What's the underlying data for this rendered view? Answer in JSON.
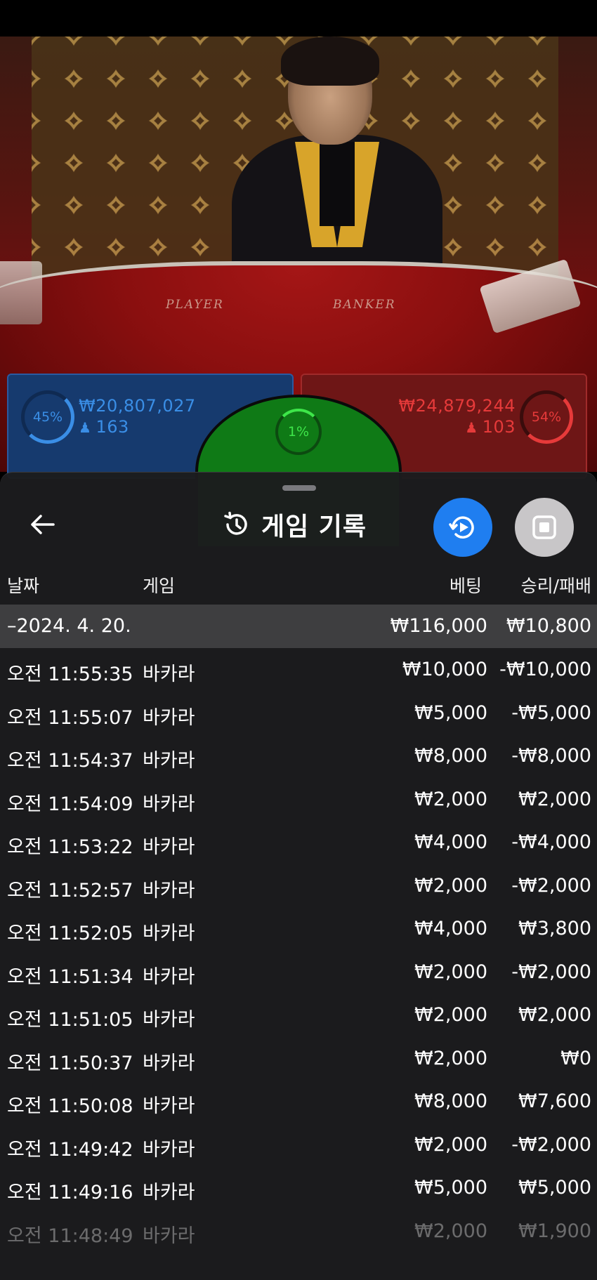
{
  "video": {
    "table_player_label": "PLAYER",
    "table_banker_label": "BANKER"
  },
  "bets": {
    "player": {
      "percent": "45%",
      "amount": "₩20,807,027",
      "count": "163",
      "color": "#3a8ee6"
    },
    "tie": {
      "percent": "1%",
      "color": "#3ee64a"
    },
    "banker": {
      "percent": "54%",
      "amount": "₩24,879,244",
      "count": "103",
      "color": "#e63a3a"
    }
  },
  "sheet": {
    "title": "게임 기록",
    "columns": {
      "date": "날짜",
      "game": "게임",
      "bet": "베팅",
      "result": "승리/패배"
    },
    "date_row": {
      "date": "–2024. 4. 20.",
      "bet": "₩116,000",
      "result": "₩10,800"
    },
    "rows": [
      {
        "time": "오전 11:55:35",
        "game": "바카라",
        "bet": "₩10,000",
        "result": "-₩10,000"
      },
      {
        "time": "오전 11:55:07",
        "game": "바카라",
        "bet": "₩5,000",
        "result": "-₩5,000"
      },
      {
        "time": "오전 11:54:37",
        "game": "바카라",
        "bet": "₩8,000",
        "result": "-₩8,000"
      },
      {
        "time": "오전 11:54:09",
        "game": "바카라",
        "bet": "₩2,000",
        "result": "₩2,000"
      },
      {
        "time": "오전 11:53:22",
        "game": "바카라",
        "bet": "₩4,000",
        "result": "-₩4,000"
      },
      {
        "time": "오전 11:52:57",
        "game": "바카라",
        "bet": "₩2,000",
        "result": "-₩2,000"
      },
      {
        "time": "오전 11:52:05",
        "game": "바카라",
        "bet": "₩4,000",
        "result": "₩3,800"
      },
      {
        "time": "오전 11:51:34",
        "game": "바카라",
        "bet": "₩2,000",
        "result": "-₩2,000"
      },
      {
        "time": "오전 11:51:05",
        "game": "바카라",
        "bet": "₩2,000",
        "result": "₩2,000"
      },
      {
        "time": "오전 11:50:37",
        "game": "바카라",
        "bet": "₩2,000",
        "result": "₩0"
      },
      {
        "time": "오전 11:50:08",
        "game": "바카라",
        "bet": "₩8,000",
        "result": "₩7,600"
      },
      {
        "time": "오전 11:49:42",
        "game": "바카라",
        "bet": "₩2,000",
        "result": "-₩2,000"
      },
      {
        "time": "오전 11:49:16",
        "game": "바카라",
        "bet": "₩5,000",
        "result": "₩5,000"
      },
      {
        "time": "오전 11:48:49",
        "game": "바카라",
        "bet": "₩2,000",
        "result": "₩1,900"
      }
    ],
    "icons": {
      "back": "arrow-left-icon",
      "title": "history-icon",
      "replay": "replay-play-icon",
      "stop": "stop-icon"
    },
    "colors": {
      "replay_button": "#1f7ef0",
      "stop_button": "#c8c6c8",
      "sheet_bg": "#1c1c1e",
      "date_row_bg": "#3e3e40"
    }
  }
}
